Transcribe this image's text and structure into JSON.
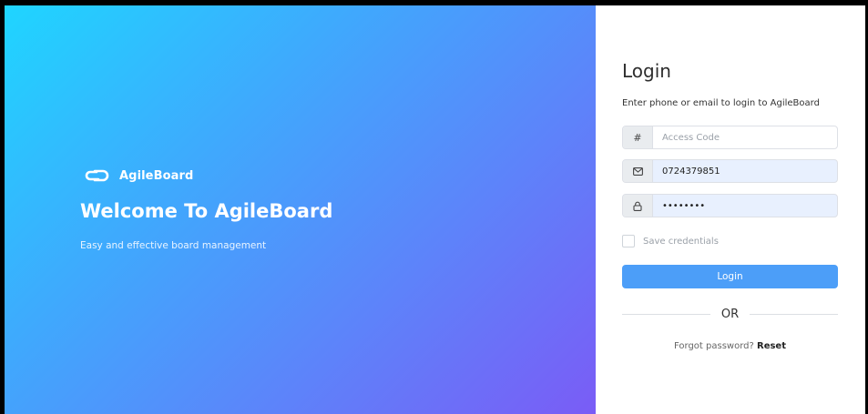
{
  "hero": {
    "brand_name": "AgileBoard",
    "title": "Welcome To AgileBoard",
    "subtitle": "Easy and effective board management"
  },
  "login": {
    "title": "Login",
    "description": "Enter phone or email to login to AgileBoard",
    "access_code": {
      "addon": "#",
      "placeholder": "Access Code",
      "value": ""
    },
    "phone": {
      "value": "0724379851"
    },
    "password": {
      "value": "password"
    },
    "remember_label": "Save credentials",
    "submit_label": "Login",
    "divider_text": "OR",
    "forgot_text": "Forgot password?",
    "reset_link": "Reset"
  },
  "colors": {
    "gradient_start": "#1fd5ff",
    "gradient_end": "#7a5cf6",
    "button": "#4c9ef8",
    "autofill_bg": "#e8f0fe"
  },
  "icons": {
    "brand": "link-icon",
    "access_code": "hash-icon",
    "email": "envelope-icon",
    "password": "lock-icon"
  }
}
